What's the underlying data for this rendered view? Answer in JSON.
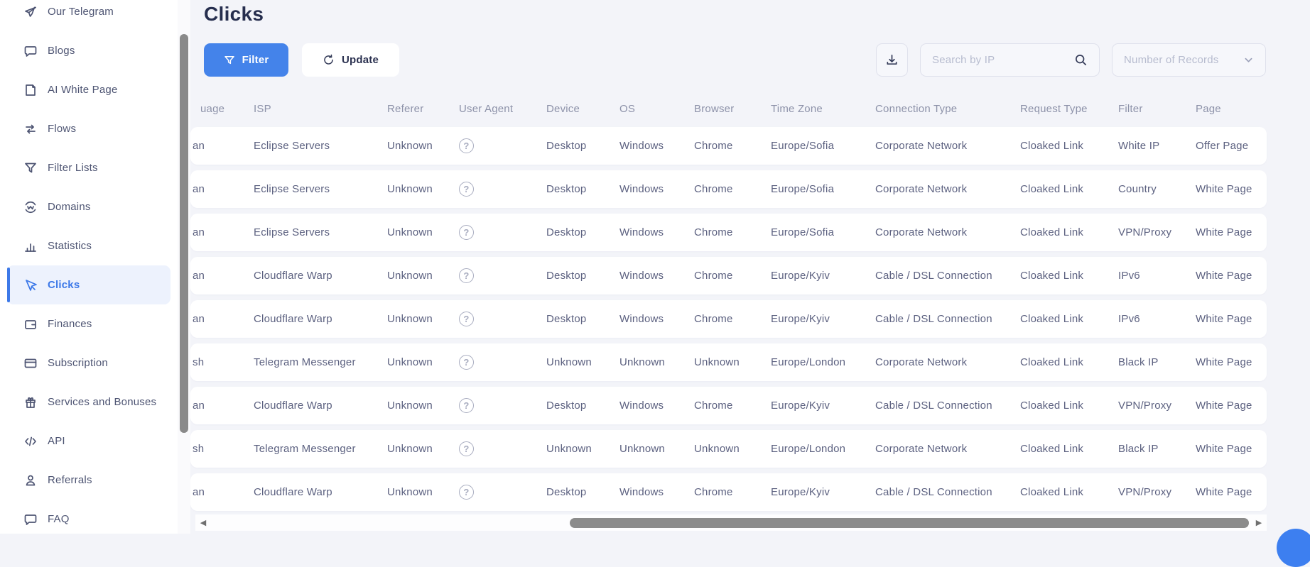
{
  "sidebar": {
    "items": [
      {
        "label": "Our Telegram",
        "icon": "telegram-icon",
        "active": false
      },
      {
        "label": "Blogs",
        "icon": "chat-bubble-icon",
        "active": false
      },
      {
        "label": "AI White Page",
        "icon": "page-icon",
        "active": false
      },
      {
        "label": "Flows",
        "icon": "flows-icon",
        "active": false
      },
      {
        "label": "Filter Lists",
        "icon": "funnel-icon",
        "active": false
      },
      {
        "label": "Domains",
        "icon": "globe-icon",
        "active": false
      },
      {
        "label": "Statistics",
        "icon": "bar-chart-icon",
        "active": false
      },
      {
        "label": "Clicks",
        "icon": "cursor-icon",
        "active": true
      },
      {
        "label": "Finances",
        "icon": "wallet-icon",
        "active": false
      },
      {
        "label": "Subscription",
        "icon": "credit-card-icon",
        "active": false
      },
      {
        "label": "Services and Bonuses",
        "icon": "gift-icon",
        "active": false
      },
      {
        "label": "API",
        "icon": "code-icon",
        "active": false
      },
      {
        "label": "Referrals",
        "icon": "person-icon",
        "active": false
      },
      {
        "label": "FAQ",
        "icon": "faq-icon",
        "active": false
      }
    ]
  },
  "header": {
    "title": "Clicks"
  },
  "toolbar": {
    "filter_label": "Filter",
    "update_label": "Update",
    "search_placeholder": "Search by IP",
    "records_placeholder": "Number of Records"
  },
  "table": {
    "columns": [
      "uage",
      "ISP",
      "Referer",
      "User Agent",
      "Device",
      "OS",
      "Browser",
      "Time Zone",
      "Connection Type",
      "Request Type",
      "Filter",
      "Page"
    ],
    "user_agent_icon": "?",
    "rows": [
      {
        "language": "an",
        "isp": "Eclipse Servers",
        "referer": "Unknown",
        "device": "Desktop",
        "os": "Windows",
        "browser": "Chrome",
        "time_zone": "Europe/Sofia",
        "connection_type": "Corporate Network",
        "request_type": "Cloaked Link",
        "filter": "White IP",
        "page": "Offer Page"
      },
      {
        "language": "an",
        "isp": "Eclipse Servers",
        "referer": "Unknown",
        "device": "Desktop",
        "os": "Windows",
        "browser": "Chrome",
        "time_zone": "Europe/Sofia",
        "connection_type": "Corporate Network",
        "request_type": "Cloaked Link",
        "filter": "Country",
        "page": "White Page"
      },
      {
        "language": "an",
        "isp": "Eclipse Servers",
        "referer": "Unknown",
        "device": "Desktop",
        "os": "Windows",
        "browser": "Chrome",
        "time_zone": "Europe/Sofia",
        "connection_type": "Corporate Network",
        "request_type": "Cloaked Link",
        "filter": "VPN/Proxy",
        "page": "White Page"
      },
      {
        "language": "an",
        "isp": "Cloudflare Warp",
        "referer": "Unknown",
        "device": "Desktop",
        "os": "Windows",
        "browser": "Chrome",
        "time_zone": "Europe/Kyiv",
        "connection_type": "Cable / DSL Connection",
        "request_type": "Cloaked Link",
        "filter": "IPv6",
        "page": "White Page"
      },
      {
        "language": "an",
        "isp": "Cloudflare Warp",
        "referer": "Unknown",
        "device": "Desktop",
        "os": "Windows",
        "browser": "Chrome",
        "time_zone": "Europe/Kyiv",
        "connection_type": "Cable / DSL Connection",
        "request_type": "Cloaked Link",
        "filter": "IPv6",
        "page": "White Page"
      },
      {
        "language": "sh",
        "isp": "Telegram Messenger",
        "referer": "Unknown",
        "device": "Unknown",
        "os": "Unknown",
        "browser": "Unknown",
        "time_zone": "Europe/London",
        "connection_type": "Corporate Network",
        "request_type": "Cloaked Link",
        "filter": "Black IP",
        "page": "White Page"
      },
      {
        "language": "an",
        "isp": "Cloudflare Warp",
        "referer": "Unknown",
        "device": "Desktop",
        "os": "Windows",
        "browser": "Chrome",
        "time_zone": "Europe/Kyiv",
        "connection_type": "Cable / DSL Connection",
        "request_type": "Cloaked Link",
        "filter": "VPN/Proxy",
        "page": "White Page"
      },
      {
        "language": "sh",
        "isp": "Telegram Messenger",
        "referer": "Unknown",
        "device": "Unknown",
        "os": "Unknown",
        "browser": "Unknown",
        "time_zone": "Europe/London",
        "connection_type": "Corporate Network",
        "request_type": "Cloaked Link",
        "filter": "Black IP",
        "page": "White Page"
      },
      {
        "language": "an",
        "isp": "Cloudflare Warp",
        "referer": "Unknown",
        "device": "Desktop",
        "os": "Windows",
        "browser": "Chrome",
        "time_zone": "Europe/Kyiv",
        "connection_type": "Cable / DSL Connection",
        "request_type": "Cloaked Link",
        "filter": "VPN/Proxy",
        "page": "White Page"
      }
    ]
  },
  "colors": {
    "accent_blue": "#4483ea",
    "active_item_blue": "#3d79e8",
    "active_item_bg": "#edf2fd",
    "main_bg": "#f3f4f9",
    "cell_text": "#5c6180",
    "header_text": "#8d92a9",
    "scrollbar_thumb": "#8a8a8a"
  }
}
